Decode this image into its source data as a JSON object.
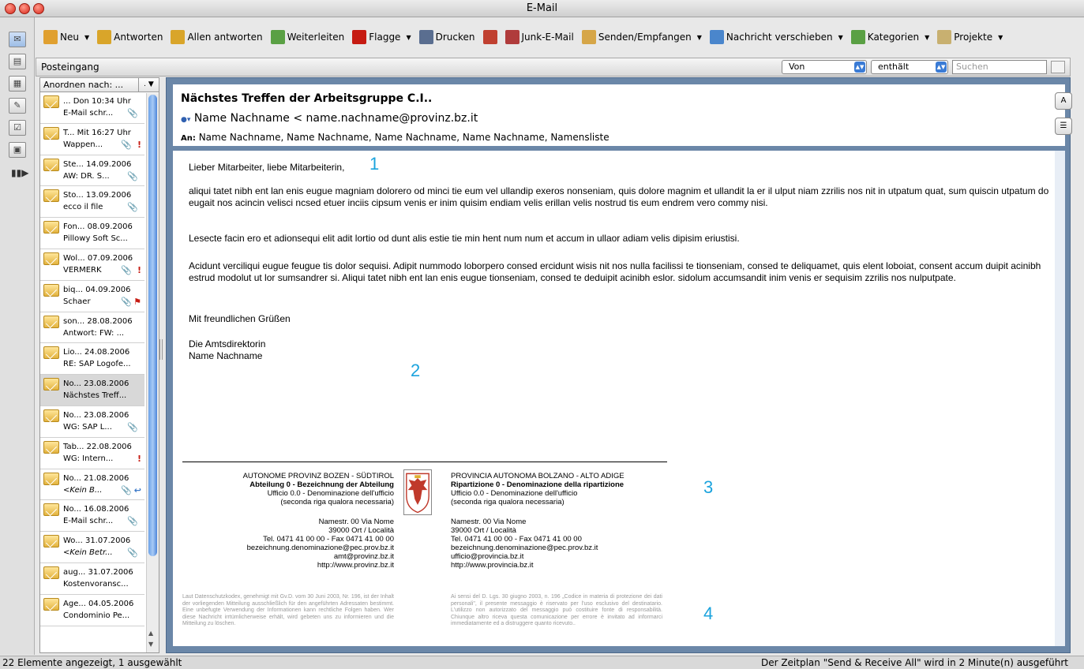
{
  "window": {
    "title": "E-Mail"
  },
  "toolbar": {
    "items": [
      {
        "label": "Neu",
        "caret": true,
        "color": "#e0a030"
      },
      {
        "label": "Antworten",
        "caret": false,
        "color": "#d9a52a"
      },
      {
        "label": "Allen antworten",
        "caret": false,
        "color": "#d9a52a"
      },
      {
        "label": "Weiterleiten",
        "caret": false,
        "color": "#5aa044"
      },
      {
        "label": "Flagge",
        "caret": true,
        "color": "#c61b12"
      },
      {
        "label": "Drucken",
        "caret": false,
        "color": "#5a6e90"
      },
      {
        "label": "",
        "caret": false,
        "color": "#c04030"
      },
      {
        "label": "Junk-E-Mail",
        "caret": false,
        "color": "#b03b3b"
      },
      {
        "label": "Senden/Empfangen",
        "caret": true,
        "color": "#d6a648"
      },
      {
        "label": "Nachricht verschieben",
        "caret": true,
        "color": "#4a86cc"
      },
      {
        "label": "Kategorien",
        "caret": true,
        "color": "#5aa044"
      },
      {
        "label": "Projekte",
        "caret": true,
        "color": "#c8b070"
      }
    ]
  },
  "folderbar": {
    "name": "Posteingang",
    "filter_field": "Von",
    "filter_op": "enthält",
    "search_placeholder": "Suchen"
  },
  "list": {
    "header": "Anordnen nach: ...",
    "sort_icon": ". ▼",
    "items": [
      {
        "line1": "... Don 10:34 Uhr",
        "line2": "E-Mail schr...",
        "italic": false,
        "clip": true,
        "flag": ""
      },
      {
        "line1": "T... Mit 16:27 Uhr",
        "line2": "Wappen...",
        "italic": false,
        "clip": true,
        "flag": "!"
      },
      {
        "line1": "Ste... 14.09.2006",
        "line2": "AW: DR. S...",
        "italic": false,
        "clip": true,
        "flag": ""
      },
      {
        "line1": "Sto... 13.09.2006",
        "line2": "ecco il file",
        "italic": false,
        "clip": true,
        "flag": ""
      },
      {
        "line1": "Fon... 08.09.2006",
        "line2": "Pillowy Soft Sc...",
        "italic": false,
        "clip": false,
        "flag": ""
      },
      {
        "line1": "Wol... 07.09.2006",
        "line2": "VERMERK",
        "italic": false,
        "clip": true,
        "flag": "!"
      },
      {
        "line1": "biq... 04.09.2006",
        "line2": "Schaer",
        "italic": false,
        "clip": true,
        "flag": "⚑"
      },
      {
        "line1": "son... 28.08.2006",
        "line2": "Antwort: FW: ...",
        "italic": false,
        "clip": false,
        "flag": ""
      },
      {
        "line1": "Lio... 24.08.2006",
        "line2": "RE: SAP Logofe...",
        "italic": false,
        "clip": false,
        "flag": ""
      },
      {
        "line1": "No... 23.08.2006",
        "line2": "Nächstes Treff...",
        "italic": false,
        "clip": false,
        "flag": "",
        "selected": true
      },
      {
        "line1": "No... 23.08.2006",
        "line2": "WG: SAP L...",
        "italic": false,
        "clip": true,
        "flag": ""
      },
      {
        "line1": "Tab... 22.08.2006",
        "line2": "WG: Intern...",
        "italic": false,
        "clip": false,
        "flag": "!"
      },
      {
        "line1": "No... 21.08.2006",
        "line2": "<Kein B...",
        "italic": true,
        "clip": true,
        "flag": "↩"
      },
      {
        "line1": "No... 16.08.2006",
        "line2": "E-Mail schr...",
        "italic": false,
        "clip": true,
        "flag": ""
      },
      {
        "line1": "Wo... 31.07.2006",
        "line2": "<Kein Betr...",
        "italic": true,
        "clip": true,
        "flag": ""
      },
      {
        "line1": "aug... 31.07.2006",
        "line2": "Kostenvoransc...",
        "italic": false,
        "clip": false,
        "flag": ""
      },
      {
        "line1": "Age... 04.05.2006",
        "line2": "Condominio Pe...",
        "italic": false,
        "clip": false,
        "flag": ""
      }
    ]
  },
  "message": {
    "subject": "Nächstes Treffen der Arbeitsgruppe C.I..",
    "from": "Name Nachname < name.nachname@provinz.bz.it",
    "to_label": "An:",
    "to": "Name Nachname, Name Nachname, Name Nachname, Name Nachname, Namensliste",
    "greeting": "Lieber Mitarbeiter, liebe Mitarbeiterin,",
    "p1": "aliqui tatet nibh ent lan enis eugue magniam dolorero od minci tie eum vel ullandip exeros nonseniam, quis dolore magnim et ullandit la er il ulput niam zzrilis nos nit in utpatum quat, sum quiscin utpatum do eugait nos acincin velisci ncsed etuer inciis cipsum venis er inim quisim endiam velis erillan velis nostrud tis eum endrem vero commy nisi.",
    "p2": "Lesecte facin ero et adionsequi elit adit lortio od dunt alis estie tie min hent num num et accum in ullaor adiam velis dipisim eriustisi.",
    "p3": "Acidunt verciliqui eugue feugue tis dolor sequisi. Adipit nummodo loborpero consed ercidunt wisis nit nos nulla facilissi te tionseniam, consed te deliquamet, quis elent loboiat, consent accum duipit acinibh estrud modolut ut lor sumsandrer si. Aliqui tatet nibh ent lan enis eugue tionseniam, consed te deduipit acinibh eslor. sidolum accumsandit inim venis er sequisim zzrilis nos nulputpate.",
    "closing": "Mit freundlichen Grüßen",
    "sign1": "Die Amtsdirektorin",
    "sign2": "Name Nachname"
  },
  "annotations": {
    "n1": "1",
    "n2": "2",
    "n3": "3",
    "n4": "4"
  },
  "signature": {
    "de_org": "AUTONOME PROVINZ BOZEN - SÜDTIROL",
    "de_dept": "Abteilung 0 - Bezeichnung der Abteilung",
    "de_office": "Ufficio 0.0 - Denominazione dell'ufficio",
    "de_office2": "(seconda riga qualora necessaria)",
    "de_addr1": "Namestr. 00 Via Nome",
    "de_addr2": "39000 Ort / Località",
    "de_tel": "Tel. 0471 41 00 00 - Fax 0471 41 00 00",
    "de_pec": "bezeichnung.denominazione@pec.prov.bz.it",
    "de_mail": "amt@provinz.bz.it",
    "de_web": "http://www.provinz.bz.it",
    "it_org": "PROVINCIA AUTONOMA BOLZANO - ALTO ADIGE",
    "it_dept": "Ripartizione 0 - Denominazione della ripartizione",
    "it_office": "Ufficio 0.0 - Denominazione dell'ufficio",
    "it_office2": "(seconda riga qualora necessaria)",
    "it_addr1": "Namestr. 00 Via Nome",
    "it_addr2": "39000 Ort / Località",
    "it_tel": "Tel. 0471 41 00 00 - Fax 0471 41 00 00",
    "it_pec": "bezeichnung.denominazione@pec.prov.bz.it",
    "it_mail": "ufficio@provincia.bz.it",
    "it_web": "http://www.provincia.bz.it",
    "de_legal": "Laut Datenschutzkodex, genehmigt mit Gv.D. vom 30 Juni 2003, Nr. 196, ist der Inhalt der vorliegenden Mitteilung ausschließlich für den angeführten Adressaten bestimmt. Eine unbefugte Verwendung der Informationen kann rechtliche Folgen haben. Wer diese Nachricht irrtümlicherweise erhält, wird gebeten uns zu informieren und die Mitteilung zu löschen.",
    "it_legal": "Ai sensi del D. Lgs. 30 giugno 2003, n. 196 „Codice in materia di protezione dei dati personali\", il presente messaggio è riservato per l'uso esclusivo del destinatario. L'utilizzo non autorizzato del messaggio può costituire fonte di responsabilità. Chiunque altro riceva questa comunicazione per errore è invitato ad informarci immediatamente ed a distruggere quanto ricevuto.."
  },
  "status": {
    "left": "22 Elemente angezeigt, 1 ausgewählt",
    "right": "Der Zeitplan \"Send & Receive All\" wird in 2 Minute(n) ausgeführt"
  }
}
